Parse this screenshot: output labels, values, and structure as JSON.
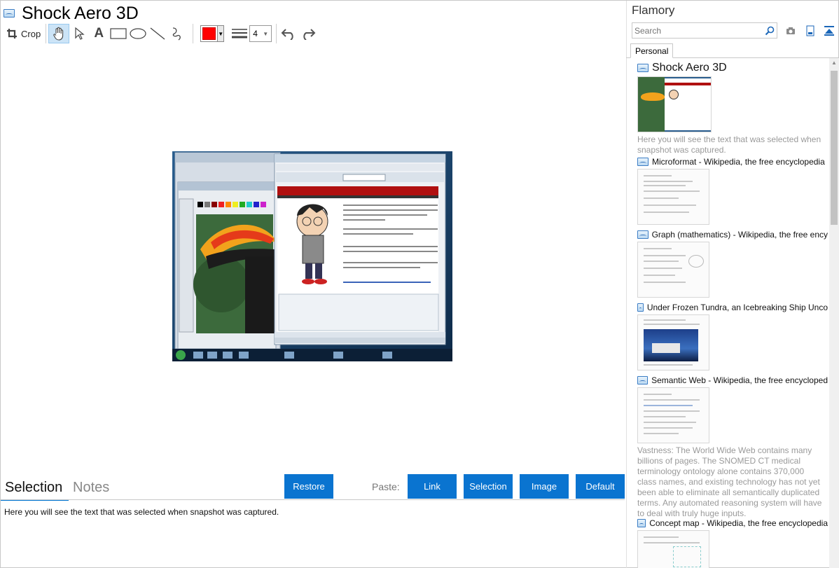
{
  "window": {
    "title": "Shock Aero 3D"
  },
  "toolbar": {
    "crop_label": "Crop",
    "icons": [
      "hand-icon",
      "pointer-icon",
      "text-icon",
      "rectangle-icon",
      "ellipse-icon",
      "line-icon",
      "freehand-icon",
      "line-width-icon",
      "undo-icon",
      "redo-icon"
    ],
    "color_value": "#ff0000",
    "line_width": "4"
  },
  "bottom": {
    "tabs": [
      "Selection",
      "Notes"
    ],
    "active_tab": "Selection",
    "restore_label": "Restore",
    "paste_label": "Paste:",
    "paste_buttons": [
      "Link",
      "Selection",
      "Image",
      "Default"
    ],
    "selection_text": "Here you will see the text that was selected when snapshot was captured."
  },
  "sidebar": {
    "title": "Flamory",
    "search_placeholder": "Search",
    "tab": "Personal",
    "items": [
      {
        "title": "Shock Aero 3D",
        "desc": "Here you will see the text that was selected when snapshot was captured."
      },
      {
        "title": "Microformat - Wikipedia, the free encyclopedia",
        "desc": ""
      },
      {
        "title": "Graph (mathematics) - Wikipedia, the free ency",
        "desc": ""
      },
      {
        "title": "Under Frozen Tundra, an Icebreaking Ship Unco",
        "desc": ""
      },
      {
        "title": "Semantic Web - Wikipedia, the free encycloped",
        "desc": "Vastness: The World Wide Web contains many billions of pages. The SNOMED CT medical terminology ontology alone contains 370,000 class names, and existing technology has not yet been able to eliminate all semantically duplicated terms. Any automated reasoning system will have to deal with truly huge inputs."
      },
      {
        "title": "Concept map - Wikipedia, the free encyclopedia",
        "desc": ""
      }
    ]
  },
  "colors": {
    "accent": "#0a74d0",
    "selected_tool": "#cce4f7"
  }
}
